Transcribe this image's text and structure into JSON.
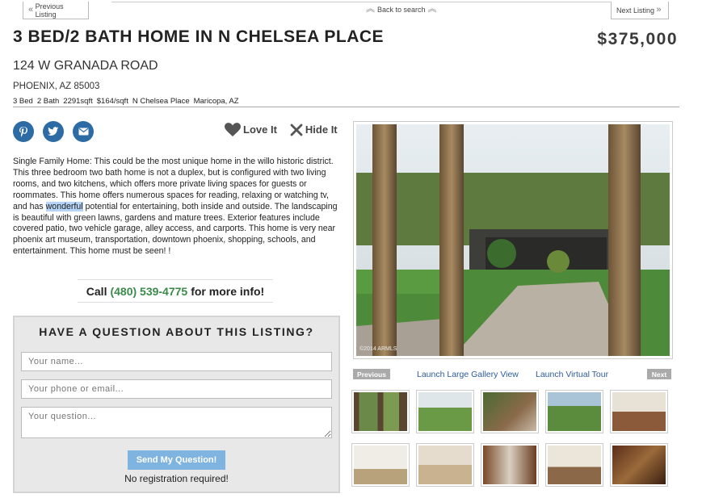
{
  "nav": {
    "previous": "Previous Listing",
    "back": "Back to search",
    "next": "Next Listing"
  },
  "listing": {
    "title": "3 BED/2 BATH HOME IN N CHELSEA PLACE",
    "price": "$375,000",
    "address": "124 W GRANADA ROAD",
    "city": "PHOENIX, AZ 85003",
    "facts": [
      "3 Bed",
      "2 Bath",
      "2291sqft",
      "$164/sqft",
      "N Chelsea Place",
      "Maricopa, AZ"
    ]
  },
  "social": {
    "icons": [
      "pinterest-icon",
      "twitter-icon",
      "email-icon"
    ],
    "love": "Love It",
    "hide": "Hide It"
  },
  "description": {
    "before": "Single Family Home: This could be the most unique home in the willo historic district. This three bedroom two bath home is not a duplex, but is configured with two living rooms, and two kitchens, which offers more private living spaces for guests or roommates. This home offers numerous spaces for reading, relaxing or watching tv, and has ",
    "highlight": "wonderful",
    "after": " potential for entertaining, both inside and outside. The landscaping is beautiful with green lawns, gardens and mature trees. Exterior features include covered patio, two vehicle garage, alley access, and carports. This home is very near phoenix art museum, transportation, downtown phoenix, shopping, schools, and entertainment. This home must be seen! !"
  },
  "call": {
    "prefix": "Call",
    "phone": "(480) 539-4775",
    "suffix": "for more info!"
  },
  "form": {
    "title": "HAVE A QUESTION ABOUT THIS LISTING?",
    "name_placeholder": "Your name...",
    "phone_placeholder": "Your phone or email...",
    "question_placeholder": "Your question...",
    "send": "Send My Question!",
    "note": "No registration required!"
  },
  "gallery": {
    "watermark": "©2014 ARMLS",
    "previous": "Previous",
    "large": "Launch Large Gallery View",
    "tour": "Launch Virtual Tour",
    "next": "Next"
  },
  "colors": {
    "accent_blue": "#2d6ba4",
    "phone_green": "#3a8a4a",
    "link_blue": "#2d5c9c",
    "button_blue": "#7fb3e0"
  }
}
